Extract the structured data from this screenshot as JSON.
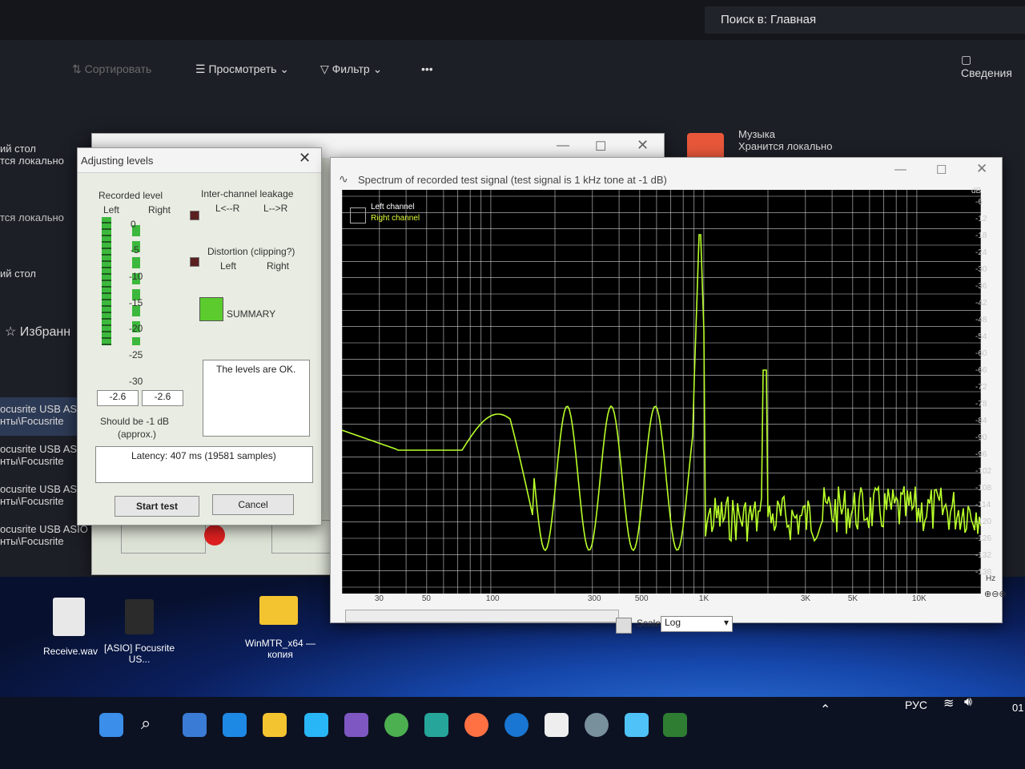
{
  "explorer": {
    "search_placeholder": "Поиск в: Главная",
    "toolbar": {
      "sort": "Сортировать",
      "view": "Просмотреть",
      "filter": "Фильтр",
      "more": "•••",
      "details": "Сведения"
    },
    "sidebar": [
      {
        "title": "ий стол",
        "sub": "тся локально"
      },
      {
        "title": "",
        "sub": "тся локально"
      },
      {
        "title": "ий стол",
        "sub": ""
      }
    ],
    "favorites": "Избранн",
    "music": {
      "title": "Музыка",
      "sub": "Хранится локально"
    },
    "files": [
      {
        "title": "ocusrite USB ASIO",
        "sub": "нты\\Focusrite"
      },
      {
        "title": "ocusrite USB ASIO",
        "sub": "нты\\Focusrite"
      },
      {
        "title": "ocusrite USB ASIO",
        "sub": "нты\\Focusrite"
      },
      {
        "title": "ocusrite USB ASIO t",
        "sub": "нты\\Focusrite"
      }
    ]
  },
  "desktop_icons": [
    {
      "label": "Receive.wav"
    },
    {
      "label": "[ASIO] Focusrite US..."
    },
    {
      "label": "WinMTR_x64 — копия"
    }
  ],
  "taskbar": {
    "lang": "РУС",
    "time": "01"
  },
  "adjust_dialog": {
    "title": "Adjusting levels",
    "recorded_level": "Recorded level",
    "left": "Left",
    "right": "Right",
    "scale": [
      "0",
      "-5",
      "-10",
      "-15",
      "-20",
      "-25",
      "-30"
    ],
    "left_value": "-2.6",
    "right_value": "-2.6",
    "should_be": "Should be -1 dB",
    "approx": "(approx.)",
    "leakage": "Inter-channel leakage",
    "leak_lr": "L<--R",
    "leak_rl": "L-->R",
    "distortion": "Distortion (clipping?)",
    "dist_left": "Left",
    "dist_right": "Right",
    "summary": "SUMMARY",
    "status": "The levels are OK.",
    "latency": "Latency: 407 ms (19581 samples)",
    "start": "Start test",
    "cancel": "Cancel",
    "summary_color": "#5ccb2e"
  },
  "spectrum": {
    "title": "Spectrum of recorded test signal (test signal is 1 kHz tone at -1 dB)",
    "legend_left": "Left channel",
    "legend_right": "Right channel",
    "y_unit": "dB",
    "y_ticks": [
      "-6",
      "-12",
      "-18",
      "-24",
      "-30",
      "-36",
      "-42",
      "-48",
      "-54",
      "-60",
      "-66",
      "-72",
      "-78",
      "-84",
      "-90",
      "-96",
      "-102",
      "-108",
      "-114",
      "-120",
      "-126",
      "-132",
      "-138"
    ],
    "x_unit": "Hz",
    "x_ticks": [
      "30",
      "50",
      "100",
      "300",
      "500",
      "1K",
      "3K",
      "5K",
      "10K"
    ],
    "scale_label": "Scale",
    "scale_value": "Log",
    "line_color": "#b8ff2a"
  }
}
